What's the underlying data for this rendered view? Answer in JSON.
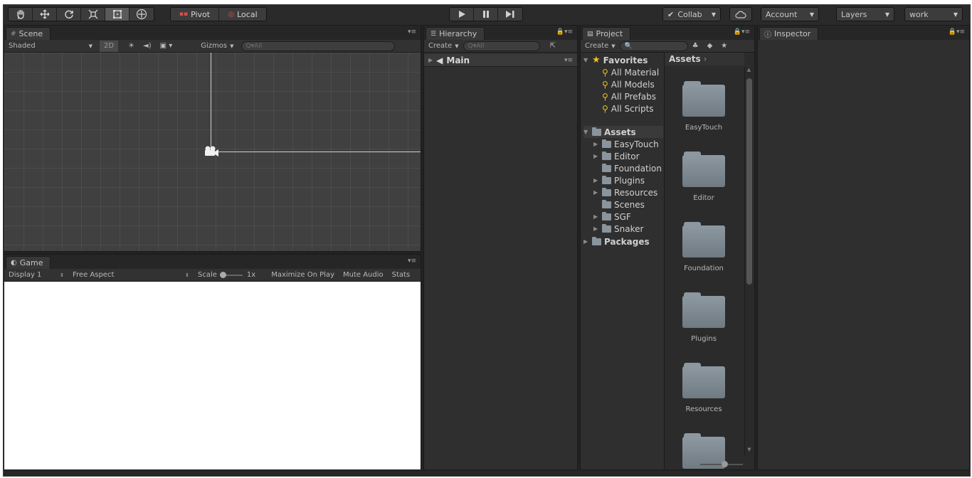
{
  "toolbar": {
    "tools": [
      "hand-tool",
      "move-tool",
      "rotate-tool",
      "scale-tool",
      "rect-tool",
      "transform-tool"
    ],
    "pivot_label": "Pivot",
    "local_label": "Local",
    "collab_label": "Collab",
    "account_label": "Account",
    "layers_label": "Layers",
    "layout_label": "work"
  },
  "scene": {
    "tab_label": "Scene",
    "shading_mode": "Shaded",
    "mode_2d": "2D",
    "gizmos_label": "Gizmos",
    "search_placeholder": "Q▾All"
  },
  "game": {
    "tab_label": "Game",
    "display": "Display 1",
    "aspect": "Free Aspect",
    "scale_label": "Scale",
    "scale_value": "1x",
    "maximize_label": "Maximize On Play",
    "mute_label": "Mute Audio",
    "stats_label": "Stats"
  },
  "hierarchy": {
    "tab_label": "Hierarchy",
    "create_label": "Create",
    "search_placeholder": "Q▾All",
    "scene_name": "Main"
  },
  "project": {
    "tab_label": "Project",
    "create_label": "Create",
    "favorites_label": "Favorites",
    "favorites": [
      "All Material",
      "All Models",
      "All Prefabs",
      "All Scripts"
    ],
    "assets_label": "Assets",
    "asset_folders": [
      {
        "name": "EasyTouch",
        "expandable": true
      },
      {
        "name": "Editor",
        "expandable": true
      },
      {
        "name": "Foundation",
        "expandable": false
      },
      {
        "name": "Plugins",
        "expandable": true
      },
      {
        "name": "Resources",
        "expandable": true
      },
      {
        "name": "Scenes",
        "expandable": false
      },
      {
        "name": "SGF",
        "expandable": true
      },
      {
        "name": "Snaker",
        "expandable": true
      }
    ],
    "packages_label": "Packages",
    "breadcrumb": "Assets",
    "grid_folders": [
      "EasyTouch",
      "Editor",
      "Foundation",
      "Plugins",
      "Resources"
    ]
  },
  "inspector": {
    "tab_label": "Inspector"
  },
  "colors": {
    "favorites_star": "#f0c020",
    "search_icon": "#e8c020"
  }
}
